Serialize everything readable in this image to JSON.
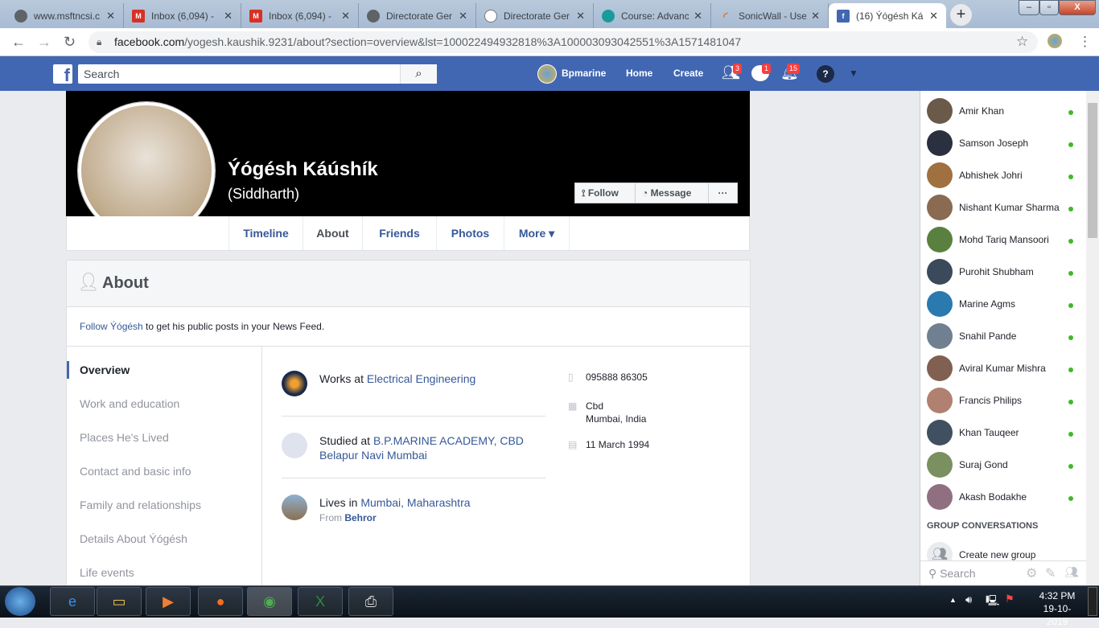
{
  "browser": {
    "tabs": [
      {
        "title": "www.msftncsi.c",
        "icon": "globe-icon"
      },
      {
        "title": "Inbox (6,094) - ",
        "icon": "gmail-icon"
      },
      {
        "title": "Inbox (6,094) - ",
        "icon": "gmail-icon"
      },
      {
        "title": "Directorate Ger",
        "icon": "globe-icon"
      },
      {
        "title": "Directorate Ger",
        "icon": "emblem-icon"
      },
      {
        "title": "Course: Advanc",
        "icon": "cloud-icon"
      },
      {
        "title": "SonicWall - Use",
        "icon": "sonicwall-icon"
      },
      {
        "title": "(16) Ýógésh Ká",
        "icon": "facebook-icon"
      }
    ],
    "url_host": "facebook.com",
    "url_path": "/yogesh.kaushik.9231/about?section=overview&lst=100022494932818%3A100003093042551%3A1571481047"
  },
  "fb": {
    "search_placeholder": "Search",
    "page_name": "Bpmarine",
    "home": "Home",
    "create": "Create",
    "friend_requests": "3",
    "messages": "1",
    "notifications": "15"
  },
  "profile": {
    "name": "Ýógésh Káúshík",
    "alt_name": "(Siddharth)",
    "follow": "Follow",
    "message": "Message",
    "more_dots": "···",
    "tabs": [
      "Timeline",
      "About",
      "Friends",
      "Photos",
      "More"
    ]
  },
  "about": {
    "title": "About",
    "follow_link": "Follow Ýógésh",
    "follow_rest": " to get his public posts in your News Feed.",
    "nav": [
      "Overview",
      "Work and education",
      "Places He's Lived",
      "Contact and basic info",
      "Family and relationships",
      "Details About Ýógésh",
      "Life events"
    ],
    "work_prefix": "Works at ",
    "work": "Electrical Engineering",
    "study_prefix": "Studied at ",
    "study": "B.P.MARINE ACADEMY, CBD Belapur Navi Mumbai",
    "lives_prefix": "Lives in ",
    "lives": "Mumbai, Maharashtra",
    "from_prefix": "From ",
    "from": "Behror",
    "phone": "095888 86305",
    "address1": "Cbd",
    "address2": "Mumbai, India",
    "birthday": "11 March 1994"
  },
  "chat": {
    "friends": [
      "Amir Khan",
      "Samson Joseph",
      "Abhishek Johri",
      "Nishant Kumar Sharma",
      "Mohd Tariq Mansoori",
      "Purohit Shubham",
      "Marine Agms",
      "Snahil Pande",
      "Aviral Kumar Mishra",
      "Francis Philips",
      "Khan Tauqeer",
      "Suraj Gond",
      "Akash Bodakhe"
    ],
    "group_header": "GROUP CONVERSATIONS",
    "create_group": "Create new group",
    "search": "Search"
  },
  "taskbar": {
    "time": "4:32 PM",
    "date": "19-10-2019"
  },
  "colors": {
    "fb_blue": "#4267b2",
    "link": "#365899",
    "online": "#42b72a"
  }
}
